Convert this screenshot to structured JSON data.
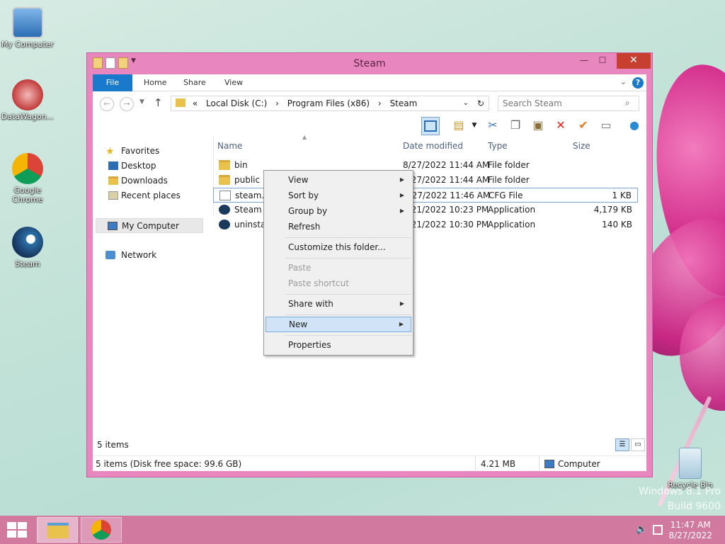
{
  "desktop": {
    "icons": [
      {
        "label": "My Computer"
      },
      {
        "label": "DataWagon..."
      },
      {
        "label": "Google Chrome"
      },
      {
        "label": "Steam"
      },
      {
        "label": "Recycle Bin"
      }
    ],
    "watermark_line1": "Windows 8.1 Pro",
    "watermark_line2": "Build 9600"
  },
  "window": {
    "title": "Steam",
    "close_glyph": "✕",
    "min_glyph": "—",
    "max_glyph": "☐",
    "ribbon_tabs": [
      "File",
      "Home",
      "Share",
      "View"
    ],
    "help_glyph": "?",
    "address": {
      "prefix": "«",
      "segments": [
        "Local Disk (C:)",
        "Program Files (x86)",
        "Steam"
      ],
      "separator": "›"
    },
    "search_placeholder": "Search Steam",
    "nav": {
      "favorites": "Favorites",
      "desktop": "Desktop",
      "downloads": "Downloads",
      "recent": "Recent places",
      "my_computer": "My Computer",
      "network": "Network"
    },
    "columns": {
      "name": "Name",
      "date": "Date modified",
      "type": "Type",
      "size": "Size"
    },
    "files": [
      {
        "name": "bin",
        "date": "8/27/2022 11:44 AM",
        "type": "File folder",
        "size": "",
        "icon": "folder"
      },
      {
        "name": "public",
        "date": "8/27/2022 11:44 AM",
        "type": "File folder",
        "size": "",
        "icon": "folder"
      },
      {
        "name": "steam.cfg",
        "date": "8/27/2022 11:46 AM",
        "type": "CFG File",
        "size": "1 KB",
        "icon": "doc"
      },
      {
        "name": "Steam",
        "date": "8/21/2022 10:23 PM",
        "type": "Application",
        "size": "4,179 KB",
        "icon": "steam"
      },
      {
        "name": "uninstall",
        "date": "8/21/2022 10:30 PM",
        "type": "Application",
        "size": "140 KB",
        "icon": "steam"
      }
    ],
    "item_count": "5 items",
    "status": {
      "left": "5 items (Disk free space: 99.6 GB)",
      "size": "4.21 MB",
      "location": "Computer"
    }
  },
  "context_menu": {
    "view": "View",
    "sort_by": "Sort by",
    "group_by": "Group by",
    "refresh": "Refresh",
    "customize": "Customize this folder...",
    "paste": "Paste",
    "paste_shortcut": "Paste shortcut",
    "share_with": "Share with",
    "new": "New",
    "properties": "Properties",
    "arrow": "▶"
  },
  "taskbar": {
    "time": "11:47 AM",
    "date": "8/27/2022"
  }
}
